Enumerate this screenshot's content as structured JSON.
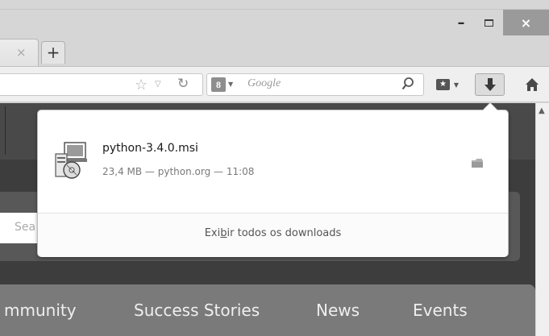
{
  "window": {
    "minimize_glyph": "–",
    "close_glyph": "×"
  },
  "tabs": {
    "tab_close_glyph": "×",
    "new_tab_glyph": "+"
  },
  "navbar": {
    "search_engine_letter": "8",
    "search_placeholder": "Google"
  },
  "downloads_panel": {
    "items": [
      {
        "file_name": "python-3.4.0.msi",
        "meta": "23,4 MB — python.org — 11:08",
        "icon": "msi-installer-icon"
      }
    ],
    "show_all_pre": "Exi",
    "show_all_accel": "b",
    "show_all_post": "ir todos os downloads"
  },
  "page": {
    "search_placeholder_partial": "Sea",
    "nav": [
      "mmunity",
      "Success Stories",
      "News",
      "Events"
    ]
  },
  "icons": {
    "star": "bookmark-star-icon",
    "reload": "reload-icon",
    "download": "download-arrow-icon",
    "home": "home-icon",
    "folder": "folder-icon"
  }
}
